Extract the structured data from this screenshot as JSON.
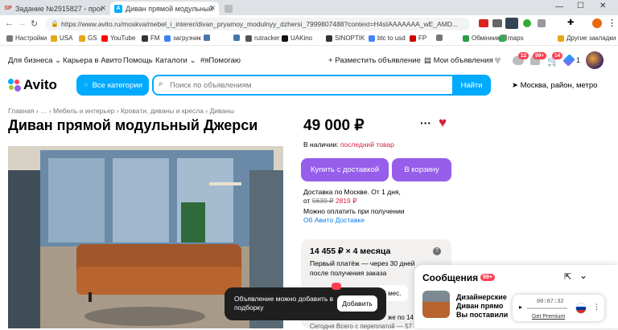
{
  "tabs": [
    {
      "label": "Задание №2915827 - просмотр з",
      "favicon": "SP"
    },
    {
      "label": "Диван прямой модульный Джерси",
      "favicon": "A"
    },
    {
      "label": "",
      "favicon": ""
    }
  ],
  "address": {
    "url": "https://www.avito.ru/moskva/mebel_i_interer/divan_pryamoy_modulnyy_dzhersi_7999807488?context=H4sIAAAAAAA_wE_AMD..."
  },
  "bookmarks": [
    "Настройки",
    "USA",
    "GS",
    "YouTube",
    "FM",
    "загрузчик",
    "",
    "",
    "rutracker",
    "UAKino",
    "SINOPTIK",
    "btc to usd",
    "FP",
    "",
    "Обмінник",
    "",
    "maps",
    "Другие закладки"
  ],
  "toplinks": {
    "business": "Для бизнеса",
    "career": "Карьера в Авито",
    "help": "Помощь",
    "catalogs": "Каталоги",
    "help_tag": "#яПомогаю",
    "post_ad": "Разместить объявление",
    "my_ads": "Мои объявления",
    "badge_msgs": "12",
    "badge_notif": "99+",
    "badge_cart": "14",
    "cart_count": "1"
  },
  "header": {
    "logo": "Avito",
    "categories": "Все категории",
    "search_placeholder": "Поиск по объявлениям",
    "search_button": "Найти",
    "region": "Москва, район, метро"
  },
  "breadcrumb": "Главная › … › Мебель и интерьер › Кровати, диваны и кресла › Диваны",
  "title": "Диван прямой модульный Джерси",
  "price": "49 000 ₽",
  "stock_label": "В наличии:",
  "stock_value": "последний товар",
  "buy_delivery": "Купить с доставкой",
  "to_cart": "В корзину",
  "delivery_line": "Доставка по Москве. От 1 дня,",
  "delivery_price_from": "от",
  "delivery_old_price": "5639 ₽",
  "delivery_new_price": "2819 ₽",
  "pay_on_receipt": "Можно оплатить при получении",
  "about_delivery": "Об Авито Доставке",
  "installment": {
    "title": "14 455 ₽ × 4 месяца",
    "text1": "Первый платёж — через 30 дней",
    "text2": "после получения заказа",
    "option": "6 мес.",
    "pay_label": "Сегодня",
    "pay_text": "Всего с переплатой — 57 8",
    "info_trunc": "же по 14 4"
  },
  "messages": {
    "title": "Сообщения",
    "badge": "99+",
    "item_line1": "Дизайнерские",
    "item_line2": "Диван прямо",
    "item_line3": "Вы поставили"
  },
  "toast": {
    "text": "Объявление можно добавить в подборку",
    "button": "Добавить"
  },
  "player": {
    "time": "00:07:32",
    "premium": "Get Premium"
  }
}
